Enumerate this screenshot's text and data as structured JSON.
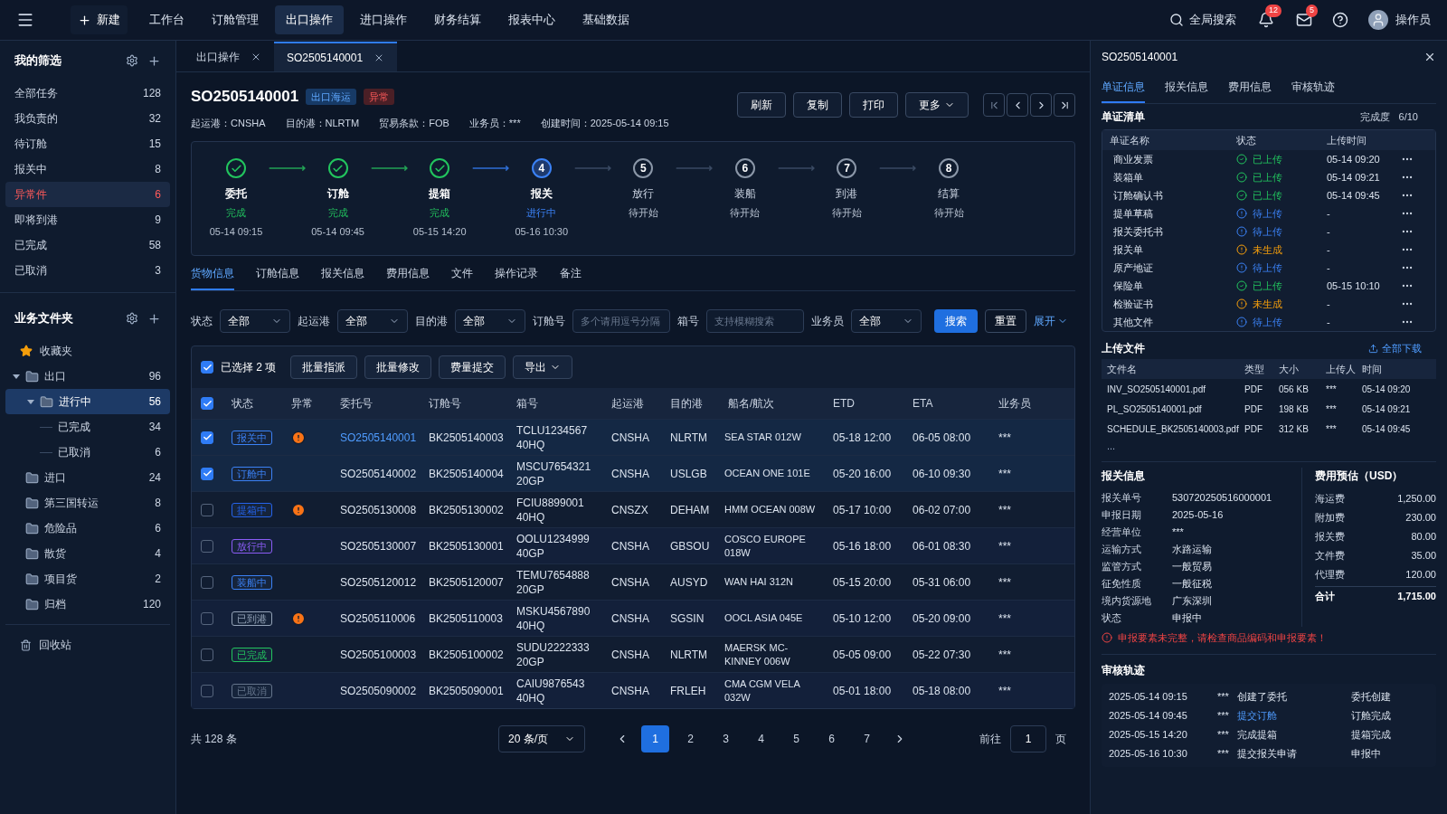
{
  "topbar": {
    "new_label": "新建",
    "menu_items": [
      {
        "label": "工作台",
        "selected": false
      },
      {
        "label": "订舱管理",
        "selected": false
      },
      {
        "label": "出口操作",
        "selected": true
      },
      {
        "label": "进口操作",
        "selected": false
      },
      {
        "label": "财务结算",
        "selected": false
      },
      {
        "label": "报表中心",
        "selected": false
      },
      {
        "label": "基础数据",
        "selected": false
      }
    ],
    "search_label": "全局搜索",
    "notifications": "12",
    "messages": "5",
    "user": "操作员"
  },
  "filters": {
    "title": "我的筛选",
    "items": [
      {
        "label": "全部任务",
        "count": "128",
        "selected": false
      },
      {
        "label": "我负责的",
        "count": "32",
        "selected": false
      },
      {
        "label": "待订舱",
        "count": "15",
        "selected": false
      },
      {
        "label": "报关中",
        "count": "8",
        "selected": false
      },
      {
        "label": "异常件",
        "count": "6",
        "selected": true
      },
      {
        "label": "即将到港",
        "count": "9",
        "selected": false
      },
      {
        "label": "已完成",
        "count": "58",
        "selected": false
      },
      {
        "label": "已取消",
        "count": "3",
        "selected": false
      }
    ]
  },
  "folders": {
    "title": "业务文件夹",
    "favorites": "收藏夹",
    "items": [
      {
        "label": "出口",
        "count": "96",
        "selected": false,
        "expanded": true,
        "children": [
          {
            "label": "进行中",
            "count": "56",
            "selected": true,
            "expanded": true
          },
          {
            "label": "已完成",
            "count": "34",
            "selected": false
          },
          {
            "label": "已取消",
            "count": "6",
            "selected": false
          }
        ]
      },
      {
        "label": "进口",
        "count": "24",
        "selected": false
      },
      {
        "label": "第三国转运",
        "count": "8",
        "selected": false
      },
      {
        "label": "危险品",
        "count": "6",
        "selected": false
      },
      {
        "label": "散货",
        "count": "4",
        "selected": false
      },
      {
        "label": "项目货",
        "count": "2",
        "selected": false
      },
      {
        "label": "归档",
        "count": "120",
        "selected": false
      }
    ],
    "trash": "回收站"
  },
  "tabs": [
    {
      "label": "出口操作",
      "selected": false
    },
    {
      "label": "SO2505140001",
      "selected": true
    }
  ],
  "order": {
    "title": "SO2505140001",
    "badges": [
      {
        "label": "出口海运",
        "kind": "info"
      },
      {
        "label": "异常",
        "kind": "danger"
      }
    ],
    "meta": [
      "起运港：CNSHA",
      "目的港：NLRTM",
      "贸易条款：FOB",
      "业务员：***",
      "创建时间：2025-05-14 09:15"
    ],
    "actions": [
      "刷新",
      "复制",
      "打印"
    ],
    "more": "更多"
  },
  "steps": [
    {
      "label": "委托",
      "status": "完成",
      "kind": "done",
      "time": "05-14 09:15"
    },
    {
      "label": "订舱",
      "status": "完成",
      "kind": "done",
      "time": "05-14 09:45"
    },
    {
      "label": "提箱",
      "status": "完成",
      "kind": "done",
      "time": "05-15 14:20"
    },
    {
      "label": "报关",
      "status": "进行中",
      "kind": "active",
      "number": "4",
      "time": "05-16 10:30"
    },
    {
      "label": "放行",
      "status": "待开始",
      "kind": "pending",
      "number": "5"
    },
    {
      "label": "装船",
      "status": "待开始",
      "kind": "pending",
      "number": "6"
    },
    {
      "label": "到港",
      "status": "待开始",
      "kind": "pending",
      "number": "7"
    },
    {
      "label": "结算",
      "status": "待开始",
      "kind": "pending",
      "number": "8"
    }
  ],
  "detail_tabs": [
    {
      "label": "货物信息",
      "selected": true
    },
    {
      "label": "订舱信息",
      "selected": false
    },
    {
      "label": "报关信息",
      "selected": false
    },
    {
      "label": "费用信息",
      "selected": false
    },
    {
      "label": "文件",
      "selected": false
    },
    {
      "label": "操作记录",
      "selected": false
    },
    {
      "label": "备注",
      "selected": false
    }
  ],
  "search_form": {
    "fields": [
      {
        "kind": "select",
        "label": "状态",
        "value": "全部"
      },
      {
        "kind": "select",
        "label": "起运港",
        "value": "全部"
      },
      {
        "kind": "select",
        "label": "目的港",
        "value": "全部"
      },
      {
        "kind": "input",
        "label": "订舱号",
        "placeholder": "多个请用逗号分隔"
      },
      {
        "kind": "input",
        "label": "箱号",
        "placeholder": "支持模糊搜索"
      },
      {
        "kind": "select",
        "label": "业务员",
        "value": "全部"
      }
    ],
    "search": "搜索",
    "reset": "重置",
    "expand": "展开"
  },
  "batch": {
    "checked": true,
    "selected_label": "已选择 2 项",
    "buttons": [
      "批量指派",
      "批量修改",
      "费量提交"
    ],
    "export": "导出"
  },
  "table": {
    "header_checked": true,
    "columns": [
      "状态",
      "异常",
      "委托号",
      "订舱号",
      "箱号",
      "起运港",
      "目的港",
      "船名/航次",
      "ETD",
      "ETA",
      "业务员"
    ],
    "rows": [
      {
        "checked": true,
        "status": "报关中",
        "color": "#3b82f6",
        "abnormal": true,
        "order_no": "SO2505140001",
        "current": true,
        "booking_no": "BK2505140003",
        "container": "TCLU1234567",
        "container_type": "40HQ",
        "pol": "CNSHA",
        "pod": "NLRTM",
        "vessel": "SEA STAR 012W",
        "etd": "05-18 12:00",
        "eta": "06-05 08:00",
        "sales": "***"
      },
      {
        "checked": true,
        "status": "订舱中",
        "color": "#3b82f6",
        "abnormal": false,
        "order_no": "SO2505140002",
        "current": false,
        "booking_no": "BK2505140004",
        "container": "MSCU7654321",
        "container_type": "20GP",
        "pol": "CNSHA",
        "pod": "USLGB",
        "vessel": "OCEAN ONE 101E",
        "etd": "05-20 16:00",
        "eta": "06-10 09:30",
        "sales": "***"
      },
      {
        "checked": false,
        "status": "提箱中",
        "color": "#2563eb",
        "abnormal": true,
        "order_no": "SO2505130008",
        "current": false,
        "booking_no": "BK2505130002",
        "container": "FCIU8899001",
        "container_type": "40HQ",
        "pol": "CNSZX",
        "pod": "DEHAM",
        "vessel": "HMM OCEAN 008W",
        "etd": "05-17 10:00",
        "eta": "06-02 07:00",
        "sales": "***"
      },
      {
        "checked": false,
        "status": "放行中",
        "color": "#8b5cf6",
        "abnormal": false,
        "order_no": "SO2505130007",
        "current": false,
        "booking_no": "BK2505130001",
        "container": "OOLU1234999",
        "container_type": "40GP",
        "pol": "CNSHA",
        "pod": "GBSOU",
        "vessel": "COSCO EUROPE 018W",
        "etd": "05-16 18:00",
        "eta": "06-01 08:30",
        "sales": "***"
      },
      {
        "checked": false,
        "status": "装船中",
        "color": "#3b82f6",
        "abnormal": false,
        "order_no": "SO2505120012",
        "current": false,
        "booking_no": "BK2505120007",
        "container": "TEMU7654888",
        "container_type": "20GP",
        "pol": "CNSHA",
        "pod": "AUSYD",
        "vessel": "WAN HAI 312N",
        "etd": "05-15 20:00",
        "eta": "05-31 06:00",
        "sales": "***"
      },
      {
        "checked": false,
        "status": "已到港",
        "color": "#94a3b8",
        "abnormal": true,
        "order_no": "SO2505110006",
        "current": false,
        "booking_no": "BK2505110003",
        "container": "MSKU4567890",
        "container_type": "40HQ",
        "pol": "CNSHA",
        "pod": "SGSIN",
        "vessel": "OOCL ASIA 045E",
        "etd": "05-10 12:00",
        "eta": "05-20 09:00",
        "sales": "***"
      },
      {
        "checked": false,
        "status": "已完成",
        "color": "#22c55e",
        "abnormal": false,
        "order_no": "SO2505100003",
        "current": false,
        "booking_no": "BK2505100002",
        "container": "SUDU2222333",
        "container_type": "20GP",
        "pol": "CNSHA",
        "pod": "NLRTM",
        "vessel": "MAERSK MC-KINNEY 006W",
        "etd": "05-05 09:00",
        "eta": "05-22 07:30",
        "sales": "***"
      },
      {
        "checked": false,
        "status": "已取消",
        "color": "#64748b",
        "abnormal": false,
        "order_no": "SO2505090002",
        "current": false,
        "booking_no": "BK2505090001",
        "container": "CAIU9876543",
        "container_type": "40HQ",
        "pol": "CNSHA",
        "pod": "FRLEH",
        "vessel": "CMA CGM VELA 032W",
        "etd": "05-01 18:00",
        "eta": "05-18 08:00",
        "sales": "***"
      }
    ]
  },
  "pagination": {
    "total": "共 128 条",
    "page_size": "20 条/页",
    "pages": [
      {
        "label": "1",
        "selected": true
      },
      {
        "label": "2",
        "selected": false
      },
      {
        "label": "3",
        "selected": false
      },
      {
        "label": "4",
        "selected": false
      },
      {
        "label": "5",
        "selected": false
      },
      {
        "label": "6",
        "selected": false
      },
      {
        "label": "7",
        "selected": false
      }
    ],
    "goto_label": "前往",
    "goto_value": "1",
    "page_unit": "页"
  },
  "panel": {
    "title": "SO2505140001",
    "tabs": [
      {
        "label": "单证信息",
        "selected": true
      },
      {
        "label": "报关信息",
        "selected": false
      },
      {
        "label": "费用信息",
        "selected": false
      },
      {
        "label": "审核轨迹",
        "selected": false
      }
    ],
    "docs": {
      "title": "单证清单",
      "progress_label": "完成度",
      "progress": "6/10",
      "columns": [
        "单证名称",
        "状态",
        "上传时间"
      ],
      "rows": [
        {
          "name": "商业发票",
          "kind": "uploaded",
          "status": "已上传",
          "time": "05-14 09:20"
        },
        {
          "name": "装箱单",
          "kind": "uploaded",
          "status": "已上传",
          "time": "05-14 09:21"
        },
        {
          "name": "订舱确认书",
          "kind": "uploaded",
          "status": "已上传",
          "time": "05-14 09:45"
        },
        {
          "name": "提单草稿",
          "kind": "pending",
          "status": "待上传",
          "time": "-"
        },
        {
          "name": "报关委托书",
          "kind": "pending",
          "status": "待上传",
          "time": "-"
        },
        {
          "name": "报关单",
          "kind": "missing",
          "status": "未生成",
          "time": "-"
        },
        {
          "name": "原产地证",
          "kind": "pending",
          "status": "待上传",
          "time": "-"
        },
        {
          "name": "保险单",
          "kind": "uploaded",
          "status": "已上传",
          "time": "05-15 10:10"
        },
        {
          "name": "检验证书",
          "kind": "missing",
          "status": "未生成",
          "time": "-"
        },
        {
          "name": "其他文件",
          "kind": "pending",
          "status": "待上传",
          "time": "-"
        }
      ]
    },
    "files": {
      "title": "上传文件",
      "download_all": "全部下载",
      "columns": [
        "文件名",
        "类型",
        "大小",
        "上传人",
        "时间"
      ],
      "rows": [
        {
          "name": "INV_SO2505140001.pdf",
          "type": "PDF",
          "size": "056 KB",
          "uploader": "***",
          "time": "05-14 09:20"
        },
        {
          "name": "PL_SO2505140001.pdf",
          "type": "PDF",
          "size": "198 KB",
          "uploader": "***",
          "time": "05-14 09:21"
        },
        {
          "name": "SCHEDULE_BK2505140003.pdf",
          "type": "PDF",
          "size": "312 KB",
          "uploader": "***",
          "time": "05-14 09:45"
        }
      ],
      "more": "..."
    },
    "customs": {
      "title": "报关信息",
      "fields": [
        {
          "label": "报关单号",
          "value": "530720250516000001"
        },
        {
          "label": "申报日期",
          "value": "2025-05-16"
        },
        {
          "label": "经营单位",
          "value": "***"
        },
        {
          "label": "运输方式",
          "value": "水路运输"
        },
        {
          "label": "监管方式",
          "value": "一般贸易"
        },
        {
          "label": "征免性质",
          "value": "一般征税"
        },
        {
          "label": "境内货源地",
          "value": "广东深圳"
        },
        {
          "label": "状态",
          "value": "申报中"
        }
      ],
      "warning": "申报要素未完整，请检查商品编码和申报要素！"
    },
    "costs": {
      "title": "费用预估（USD）",
      "items": [
        {
          "label": "海运费",
          "value": "1,250.00"
        },
        {
          "label": "附加费",
          "value": "230.00"
        },
        {
          "label": "报关费",
          "value": "80.00"
        },
        {
          "label": "文件费",
          "value": "35.00"
        },
        {
          "label": "代理费",
          "value": "120.00"
        }
      ],
      "total_label": "合计",
      "total": "1,715.00"
    },
    "audit": {
      "title": "审核轨迹",
      "rows": [
        {
          "time": "2025-05-14 09:15",
          "user": "***",
          "action": "创建了委托",
          "link": false,
          "result": "委托创建"
        },
        {
          "time": "2025-05-14 09:45",
          "user": "***",
          "action": "提交订舱",
          "link": true,
          "result": "订舱完成"
        },
        {
          "time": "2025-05-15 14:20",
          "user": "***",
          "action": "完成提箱",
          "link": false,
          "result": "提箱完成"
        },
        {
          "time": "2025-05-16 10:30",
          "user": "***",
          "action": "提交报关申请",
          "link": false,
          "result": "申报中"
        }
      ]
    }
  }
}
